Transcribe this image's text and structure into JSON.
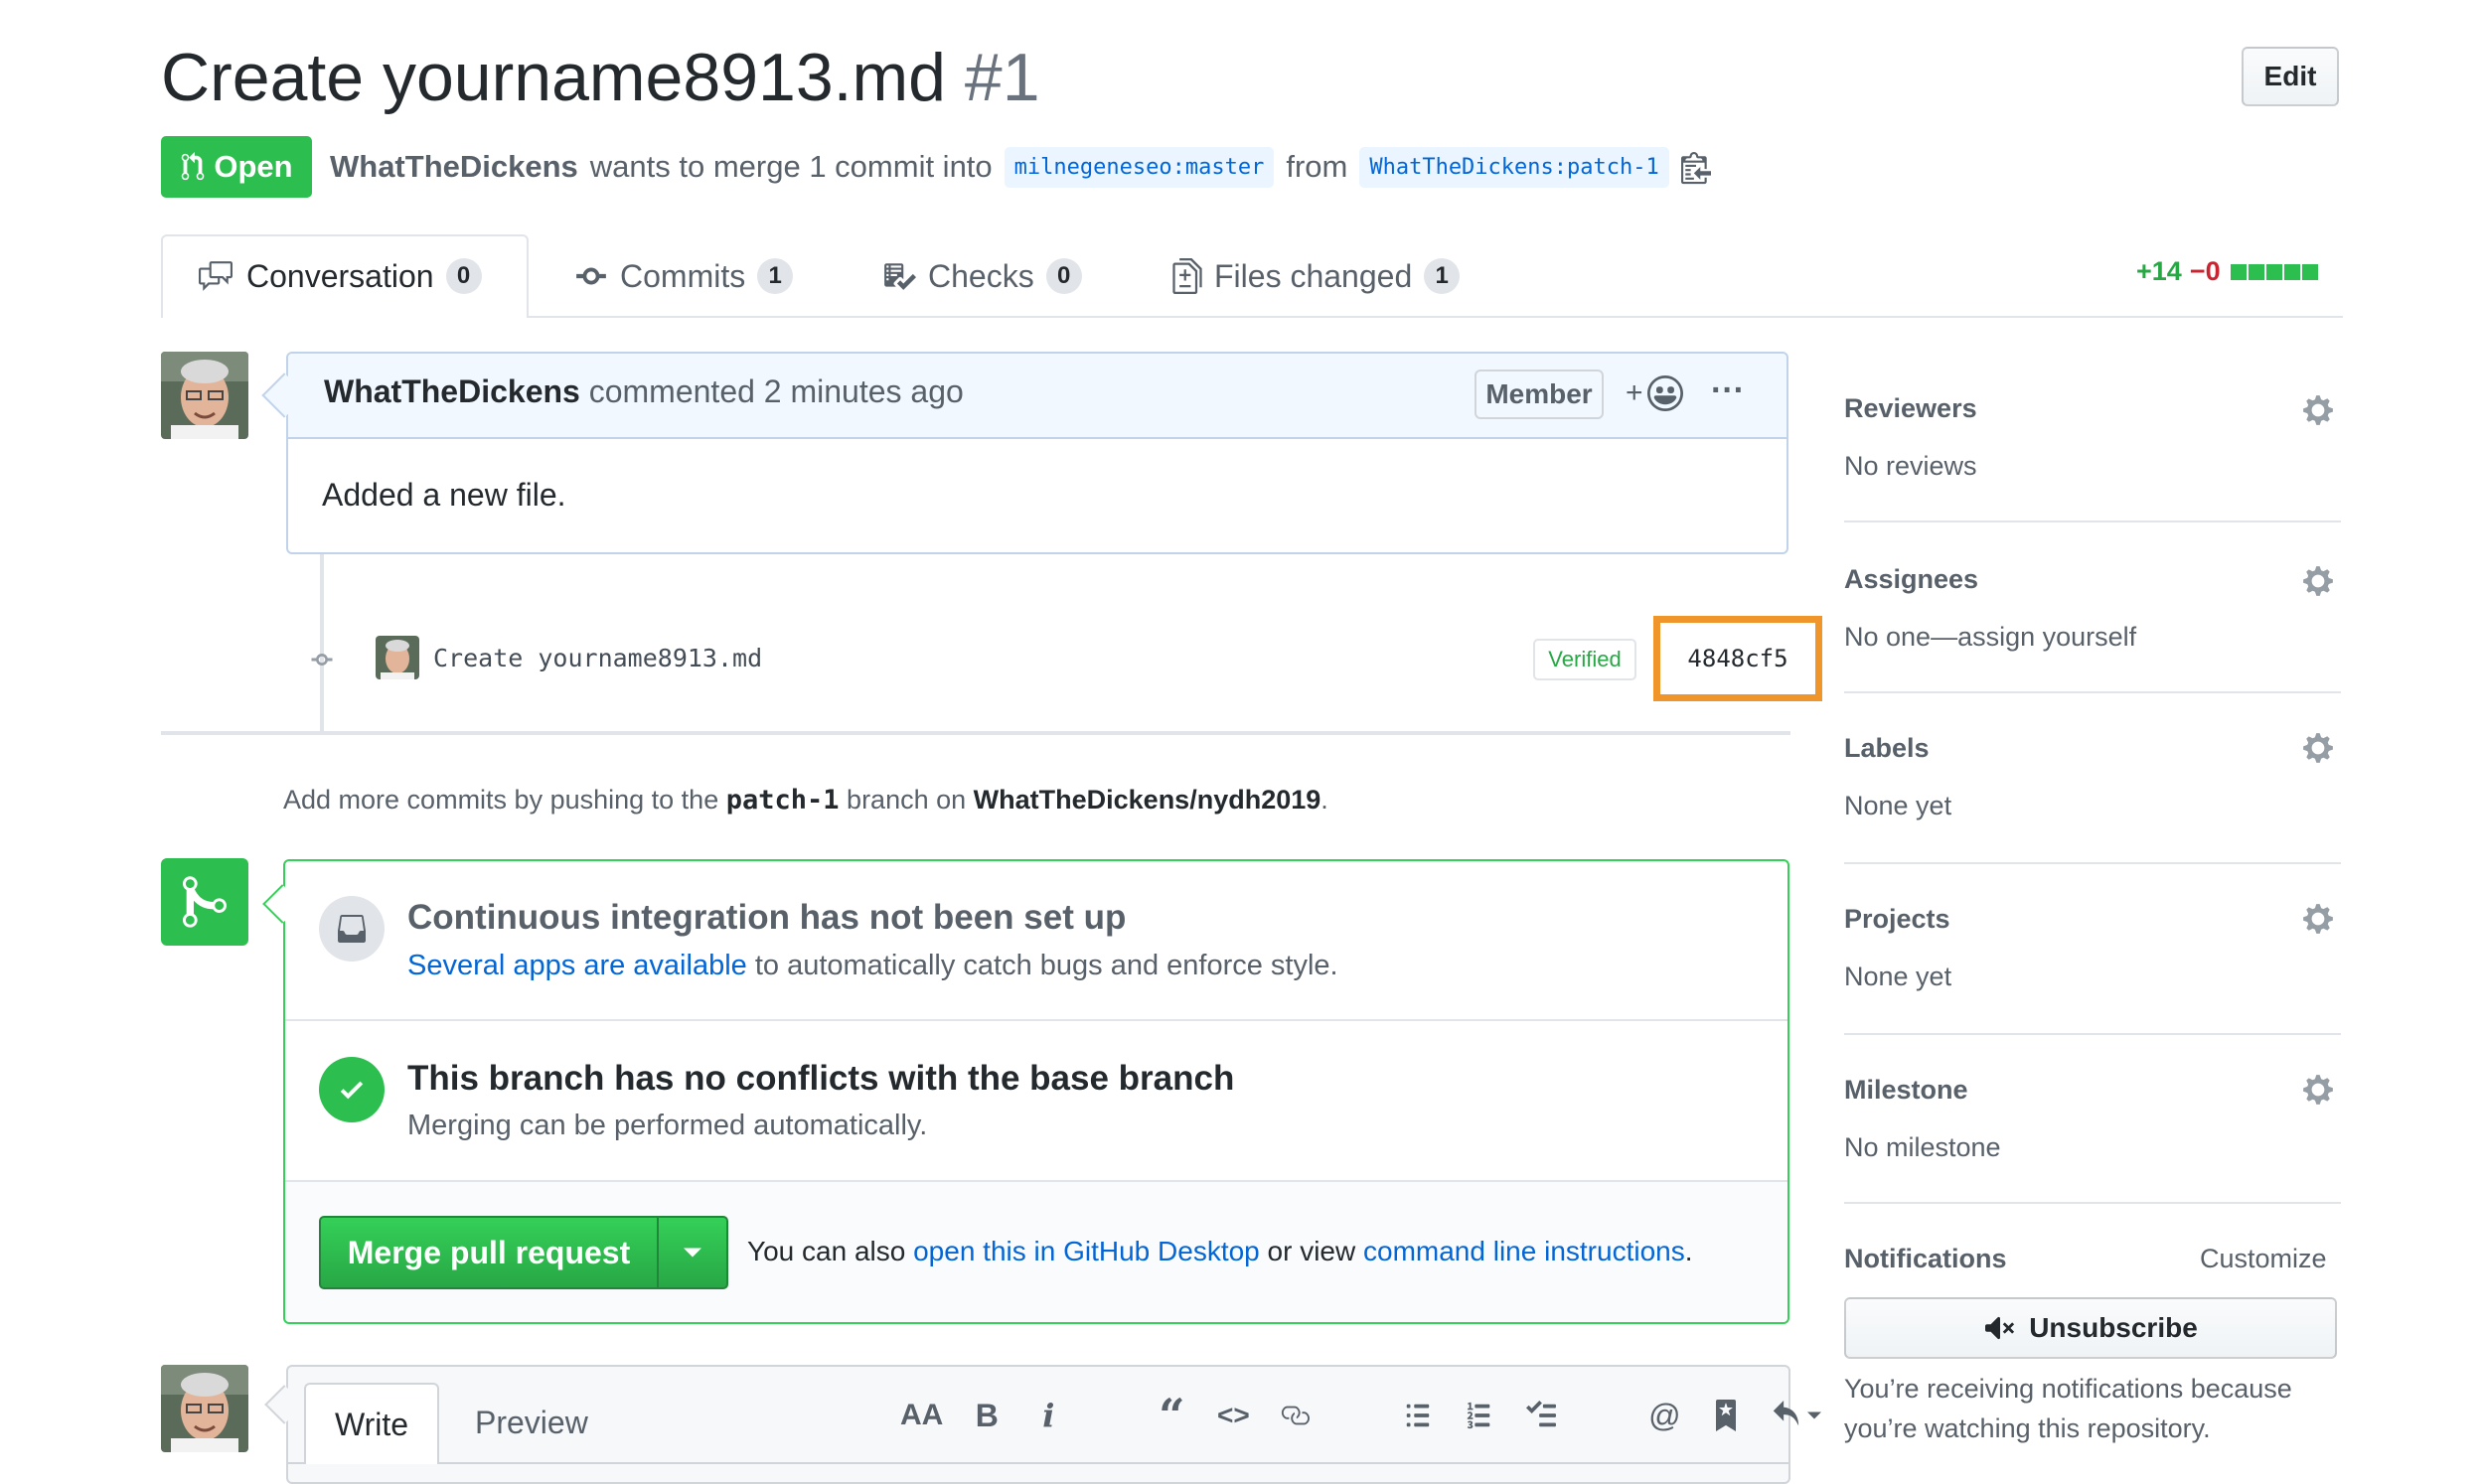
{
  "pr": {
    "title": "Create yourname8913.md",
    "number": "#1",
    "edit_label": "Edit",
    "state_label": "Open",
    "author": "WhatTheDickens",
    "merge_text": "wants to merge 1 commit into",
    "base_branch": "milnegeneseo:master",
    "from_text": "from",
    "head_branch": "WhatTheDickens:patch-1"
  },
  "tabs": [
    {
      "label": "Conversation",
      "count": "0",
      "icon": "comment-discussion-icon"
    },
    {
      "label": "Commits",
      "count": "1",
      "icon": "git-commit-icon"
    },
    {
      "label": "Checks",
      "count": "0",
      "icon": "checklist-icon"
    },
    {
      "label": "Files changed",
      "count": "1",
      "icon": "diff-icon"
    }
  ],
  "diffstat": {
    "additions": "+14",
    "deletions": "−0"
  },
  "comment": {
    "author": "WhatTheDickens",
    "action": "commented 2 minutes ago",
    "badge": "Member",
    "body": "Added a new file."
  },
  "commit": {
    "message": "Create yourname8913.md",
    "verified": "Verified",
    "sha": "4848cf5"
  },
  "push_hint": {
    "prefix": "Add more commits by pushing to the",
    "branch": "patch-1",
    "middle": "branch on",
    "repo": "WhatTheDickens/nydh2019",
    "suffix": "."
  },
  "merge": {
    "ci_title": "Continuous integration has not been set up",
    "ci_link": "Several apps are available",
    "ci_rest": "to automatically catch bugs and enforce style.",
    "ok_title": "This branch has no conflicts with the base branch",
    "ok_sub": "Merging can be performed automatically.",
    "button": "Merge pull request",
    "alt_prefix": "You can also",
    "alt_link1": "open this in GitHub Desktop",
    "alt_middle": "or view",
    "alt_link2": "command line instructions",
    "alt_suffix": "."
  },
  "write": {
    "write_tab": "Write",
    "preview_tab": "Preview"
  },
  "toolbar": {
    "heading": "AA",
    "bold": "B",
    "italic": "i"
  },
  "sidebar": {
    "reviewers": {
      "title": "Reviewers",
      "value": "No reviews"
    },
    "assignees": {
      "title": "Assignees",
      "value": "No one—assign yourself"
    },
    "labels": {
      "title": "Labels",
      "value": "None yet"
    },
    "projects": {
      "title": "Projects",
      "value": "None yet"
    },
    "milestone": {
      "title": "Milestone",
      "value": "No milestone"
    },
    "notifications": {
      "title": "Notifications",
      "customize": "Customize",
      "unsubscribe": "Unsubscribe",
      "reason": "You’re receiving notifications because you’re watching this repository."
    }
  },
  "colors": {
    "open_green": "#2cbe4e",
    "link_blue": "#0366d6",
    "highlight_orange": "#f0952a"
  }
}
